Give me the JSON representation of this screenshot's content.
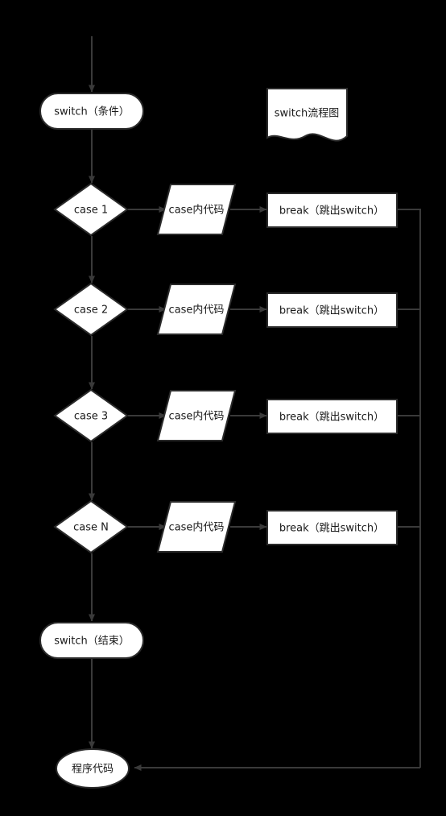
{
  "diagram": {
    "title_note": "switch流程图",
    "background_color": "#000000",
    "node_fill": "#ffffff",
    "node_stroke": "#2b2b2b",
    "edge_color": "#3a3a3a",
    "label_color": "#1a1a1a"
  },
  "nodes": {
    "start": {
      "label": "switch（条件）",
      "shape": "rounded-rect"
    },
    "case1": {
      "label": "case 1",
      "shape": "diamond"
    },
    "case2": {
      "label": "case 2",
      "shape": "diamond"
    },
    "case3": {
      "label": "case 3",
      "shape": "diamond"
    },
    "caseN": {
      "label": "case N",
      "shape": "diamond"
    },
    "code1": {
      "label": "case内代码",
      "shape": "parallelogram"
    },
    "code2": {
      "label": "case内代码",
      "shape": "parallelogram"
    },
    "code3": {
      "label": "case内代码",
      "shape": "parallelogram"
    },
    "codeN": {
      "label": "case内代码",
      "shape": "parallelogram"
    },
    "break1": {
      "label": "break（跳出switch）",
      "shape": "rect"
    },
    "break2": {
      "label": "break（跳出switch）",
      "shape": "rect"
    },
    "break3": {
      "label": "break（跳出switch）",
      "shape": "rect"
    },
    "breakN": {
      "label": "break（跳出switch）",
      "shape": "rect"
    },
    "end": {
      "label": "switch（结束）",
      "shape": "rounded-rect"
    },
    "program": {
      "label": "程序代码",
      "shape": "ellipse"
    },
    "note": {
      "label": "switch流程图",
      "shape": "document"
    }
  }
}
